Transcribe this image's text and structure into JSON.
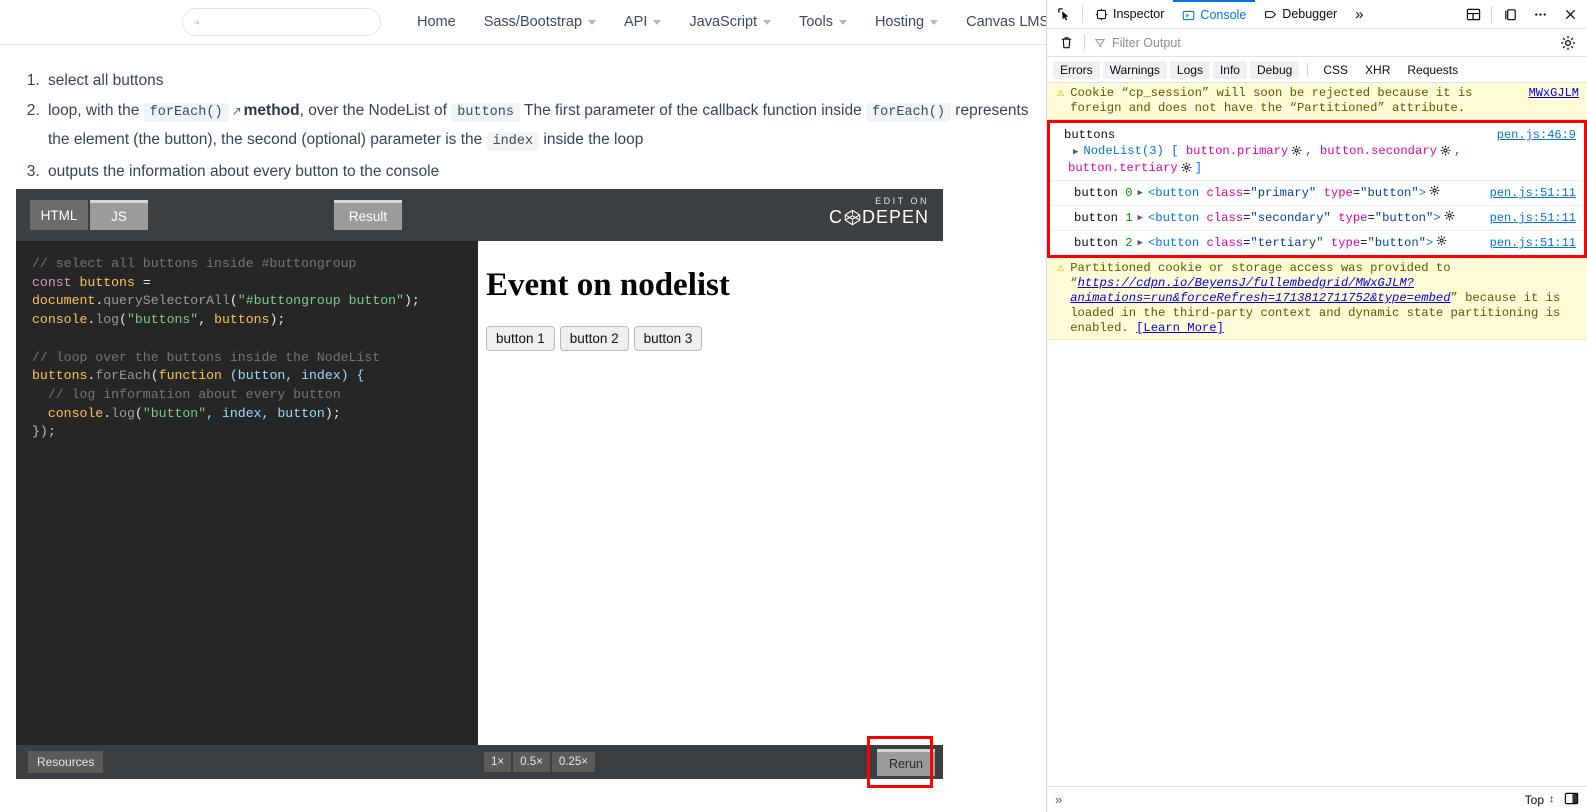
{
  "webpage": {
    "search": {
      "placeholder": "",
      "value": ""
    },
    "nav": [
      {
        "label": "Home",
        "has_caret": false,
        "external": false
      },
      {
        "label": "Sass/Bootstrap",
        "has_caret": true,
        "external": false
      },
      {
        "label": "API",
        "has_caret": true,
        "external": false
      },
      {
        "label": "JavaScript",
        "has_caret": true,
        "external": false
      },
      {
        "label": "Tools",
        "has_caret": true,
        "external": false
      },
      {
        "label": "Hosting",
        "has_caret": true,
        "external": false
      },
      {
        "label": "Canvas LMS",
        "has_caret": false,
        "external": true
      }
    ],
    "steps": {
      "item1": "select all buttons",
      "item2_a": "loop, with the",
      "item2_code1": "forEach()",
      "item2_b": "method",
      "item2_c": ", over the NodeList of",
      "item2_code2": "buttons",
      "item2_d": "The first parameter of the callback function inside",
      "item2_code3": "forEach()",
      "item2_e": "represents the element (the button), the second (optional) parameter is the",
      "item2_code4": "index",
      "item2_f": "inside the loop",
      "item3": "outputs the information about every button to the console"
    }
  },
  "codepen": {
    "tabs": [
      {
        "label": "HTML",
        "active": false
      },
      {
        "label": "JS",
        "active": true
      }
    ],
    "result_tab": "Result",
    "logo_top": "EDIT ON",
    "logo_main_left": "C",
    "logo_main_right": "DEPEN",
    "code": {
      "l1_comment": "// select all buttons inside #buttongroup",
      "l2_kw": "const",
      "l2_var": " buttons ",
      "l2_eq": "= ",
      "l2_doc": "document",
      "l2_dot": ".",
      "l2_fn": "querySelectorAll",
      "l2_open": "(",
      "l2_str": "\"#buttongroup button\"",
      "l2_close": ");",
      "l3_console": "console",
      "l3_dot": ".",
      "l3_log": "log",
      "l3_open": "(",
      "l3_str": "\"buttons\"",
      "l3_comma": ", ",
      "l3_arg": "buttons",
      "l3_close": ");",
      "l5_comment": "// loop over the buttons inside the NodeList",
      "l6_var": "buttons",
      "l6_dot": ".",
      "l6_fe": "forEach",
      "l6_open": "(",
      "l6_kw": "function",
      "l6_params": " (button, index) {",
      "l7_comment": "  // log information about every button",
      "l8_console": "  console",
      "l8_dot": ".",
      "l8_log": "log",
      "l8_open": "(",
      "l8_str": "\"button\"",
      "l8_args": ", index, button",
      "l8_close": ");",
      "l9_end": "});"
    },
    "result": {
      "heading": "Event on nodelist",
      "buttons": [
        "button 1",
        "button 2",
        "button 3"
      ]
    },
    "bottom": {
      "resources": "Resources",
      "zooms": [
        "1×",
        "0.5×",
        "0.25×"
      ],
      "rerun": "Rerun"
    }
  },
  "devtools": {
    "toolbar": {
      "picker_icon": "element-picker-icon",
      "tabs": [
        {
          "label": "Inspector",
          "icon": "inspector-icon",
          "active": false
        },
        {
          "label": "Console",
          "icon": "console-icon",
          "active": true
        },
        {
          "label": "Debugger",
          "icon": "debugger-icon",
          "active": false
        }
      ],
      "overflow": "»",
      "dock_icon": "dock-layout-icon",
      "separate_icon": "separate-window-icon",
      "meatball_icon": "more-options-icon",
      "close_icon": "close-icon"
    },
    "filterbar": {
      "trash_icon": "clear-console-icon",
      "filter_placeholder": "Filter Output",
      "settings_icon": "console-settings-icon"
    },
    "filters": {
      "pills": [
        "Errors",
        "Warnings",
        "Logs",
        "Info",
        "Debug"
      ],
      "plain": [
        "CSS",
        "XHR",
        "Requests"
      ]
    },
    "messages": {
      "warning1": {
        "text": "Cookie “cp_session” will soon be rejected because it is foreign and does not have the “Partitioned” attribute.",
        "source": "MWxGJLM"
      },
      "group": {
        "buttons_log": {
          "label": "buttons",
          "source": "pen.js:46:9",
          "nodelist": "NodeList(3)",
          "open_bracket": "[",
          "item1": "button.primary",
          "comma1": ",",
          "item2": "button.secondary",
          "comma2": ",",
          "item3": "button.tertiary",
          "close_bracket": "]"
        },
        "rows": [
          {
            "label": "button",
            "index": "0",
            "tag_open": "<button",
            "attr1": "class",
            "val1": "\"primary\"",
            "attr2": "type",
            "val2": "\"button\"",
            "tag_close": ">",
            "source": "pen.js:51:11"
          },
          {
            "label": "button",
            "index": "1",
            "tag_open": "<button",
            "attr1": "class",
            "val1": "\"secondary\"",
            "attr2": "type",
            "val2": "\"button\"",
            "tag_close": ">",
            "source": "pen.js:51:11"
          },
          {
            "label": "button",
            "index": "2",
            "tag_open": "<button",
            "attr1": "class",
            "val1": "\"tertiary\"",
            "attr2": "type",
            "val2": "\"button\"",
            "tag_close": ">",
            "source": "pen.js:51:11"
          }
        ]
      },
      "warning2": {
        "pre": "Partitioned cookie or storage access was provided to “",
        "url": "https://cdpn.io/BeyensJ/fullembedgrid/MWxGJLM?animations=run&forceRefresh=1713812711752&type=embed",
        "post": "” because it is loaded in the third-party context and dynamic state partitioning is enabled.",
        "learn_more": "[Learn More]"
      }
    },
    "statusbar": {
      "prompt": "»",
      "context": "Top",
      "split_icon": "split-console-icon"
    }
  }
}
